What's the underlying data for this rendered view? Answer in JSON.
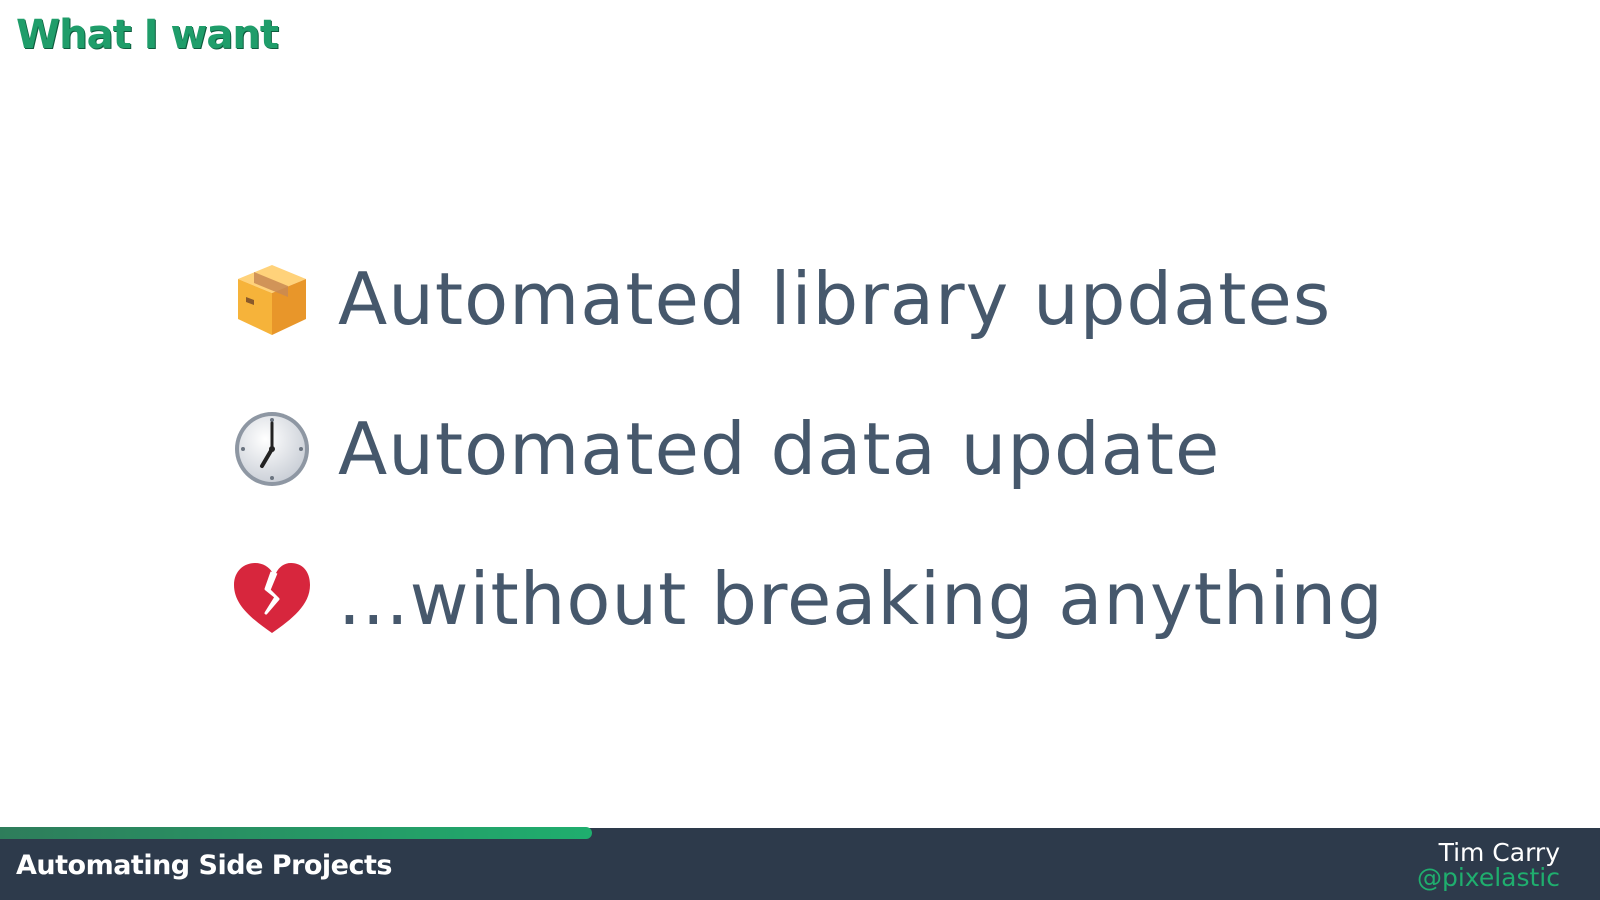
{
  "slide": {
    "title": "What I want",
    "bullets": [
      {
        "icon": "package-icon",
        "text": "Automated library updates"
      },
      {
        "icon": "clock-icon",
        "text": "Automated data update"
      },
      {
        "icon": "broken-heart-icon",
        "text": "...without breaking anything"
      }
    ]
  },
  "footer": {
    "talk_title": "Automating Side Projects",
    "author_name": "Tim Carry",
    "author_handle": "@pixelastic",
    "progress": 0.37
  },
  "colors": {
    "accent": "#1f9d6a",
    "text": "#46586c",
    "footer_bg": "#2d3a4b"
  }
}
